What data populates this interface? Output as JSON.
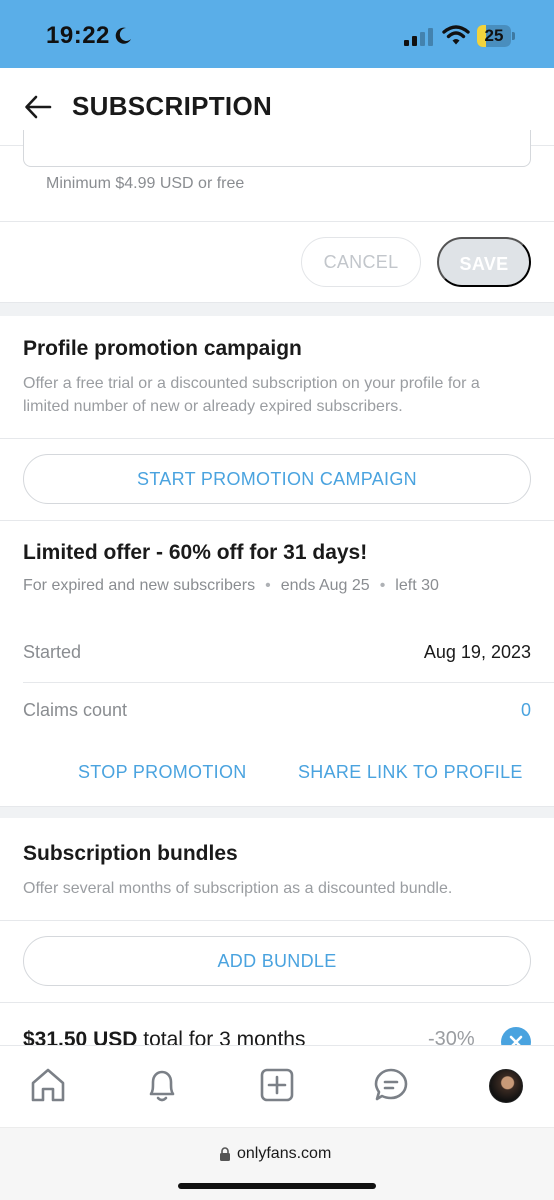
{
  "status_bar": {
    "time": "19:22",
    "battery_level": "25",
    "battery_fraction": 0.25,
    "icons": [
      "moon-icon",
      "signal-icon",
      "wifi-icon",
      "battery-icon"
    ]
  },
  "header": {
    "title": "SUBSCRIPTION",
    "back_icon": "arrow-left-icon"
  },
  "price": {
    "hint": "Minimum $4.99 USD or free"
  },
  "actions": {
    "cancel_label": "CANCEL",
    "save_label": "SAVE"
  },
  "promotion": {
    "title": "Profile promotion campaign",
    "description": "Offer a free trial or a discounted subscription on your profile for a limited number of new or already expired subscribers.",
    "start_label": "START PROMOTION CAMPAIGN"
  },
  "offer": {
    "title": "Limited offer - 60% off for 31 days!",
    "audience": "For expired and new subscribers",
    "ends": "ends Aug 25",
    "left": "left 30",
    "separator": "•",
    "rows": [
      {
        "label": "Started",
        "value": "Aug 19, 2023"
      },
      {
        "label": "Claims count",
        "value": "0"
      }
    ],
    "stop_label": "STOP PROMOTION",
    "share_label": "SHARE LINK TO PROFILE"
  },
  "bundles": {
    "title": "Subscription bundles",
    "description": "Offer several months of subscription as a discounted bundle.",
    "add_label": "ADD BUNDLE",
    "first_bundle": {
      "price": "$31.50 USD",
      "rest": " total for 3 months",
      "discount": "-30%"
    }
  },
  "bottom_nav": {
    "items": [
      "home-icon",
      "notifications-bell-icon",
      "add-post-icon",
      "messages-icon",
      "profile-avatar"
    ]
  },
  "browser": {
    "url": "onlyfans.com"
  },
  "colors": {
    "accent": "#4aa3df",
    "status_bar": "#5aaee8",
    "battery": "#f2d33c"
  }
}
